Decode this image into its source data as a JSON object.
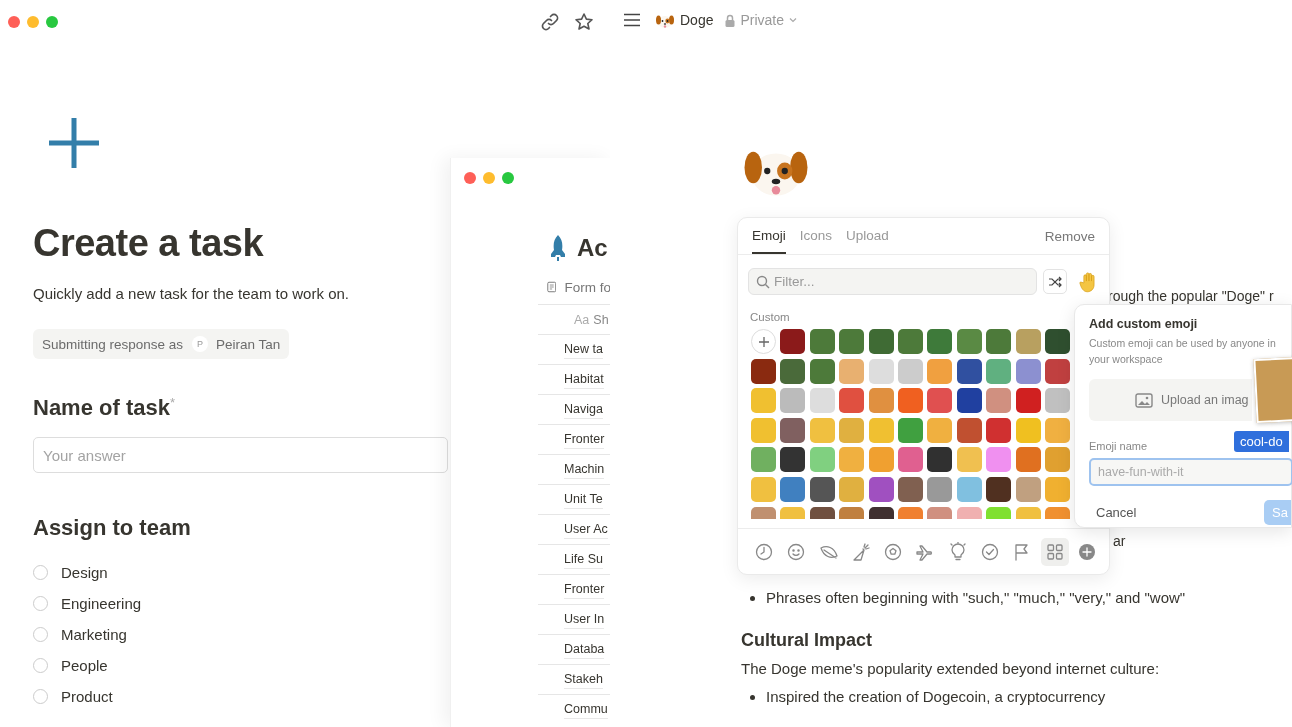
{
  "form_window": {
    "title": "Create a task",
    "description": "Quickly add a new task for the team to work on.",
    "respondent": {
      "label": "Submitting response as",
      "avatar": "P",
      "name": "Peiran Tan"
    },
    "question": {
      "label": "Name of task",
      "required_mark": "*",
      "placeholder": "Your answer"
    },
    "team_question": {
      "label": "Assign to team",
      "options": [
        {
          "label": "Design",
          "checked": false
        },
        {
          "label": "Engineering",
          "checked": false
        },
        {
          "label": "Marketing",
          "checked": false
        },
        {
          "label": "People",
          "checked": false
        },
        {
          "label": "Product",
          "checked": false
        }
      ]
    }
  },
  "database_window": {
    "title": "Ac",
    "view": "Form fo",
    "column_header": {
      "type_icon": "Aa",
      "label": "Sh"
    },
    "rows": [
      "New ta",
      "Habitat",
      "Naviga",
      "Fronter",
      "Machin",
      "Unit Te",
      "User Ac",
      "Life Su",
      "Fronter",
      "User In",
      "Databa",
      "Stakeh",
      "Commu"
    ]
  },
  "doge_page": {
    "breadcrumb": {
      "title": "Doge",
      "privacy": "Private"
    },
    "icon_picker": {
      "tabs": [
        {
          "label": "Emoji",
          "selected": true
        },
        {
          "label": "Icons",
          "selected": false
        },
        {
          "label": "Upload",
          "selected": false
        }
      ],
      "remove": "Remove",
      "filter_placeholder": "Filter...",
      "section_label": "Custom",
      "emoji": [
        {
          "color": "#8b1a1a"
        },
        {
          "color": "#4d7a3a"
        },
        {
          "color": "#4d7a3a"
        },
        {
          "color": "#3f6b34"
        },
        {
          "color": "#4d7a3a"
        },
        {
          "color": "#3e7a3a"
        },
        {
          "color": "#5a8a44"
        },
        {
          "color": "#4d7a3a"
        },
        {
          "color": "#b8a060"
        },
        {
          "color": "#2f4f2f"
        },
        {
          "color": "#8a2a10"
        },
        {
          "color": "#4a6a3a"
        },
        {
          "color": "#4d7a3a"
        },
        {
          "color": "#e8b070"
        },
        {
          "color": "#dddddd"
        },
        {
          "color": "#cccccc"
        },
        {
          "color": "#f0a040"
        },
        {
          "color": "#3050a0"
        },
        {
          "color": "#60b080"
        },
        {
          "color": "#8c90d0"
        },
        {
          "color": "#c04040"
        },
        {
          "color": "#f0c030"
        },
        {
          "color": "#bbbbbb"
        },
        {
          "color": "#dddddd"
        },
        {
          "color": "#e05040"
        },
        {
          "color": "#e09040"
        },
        {
          "color": "#f06020"
        },
        {
          "color": "#e05050"
        },
        {
          "color": "#2040a0"
        },
        {
          "color": "#d09080"
        },
        {
          "color": "#d02020"
        },
        {
          "color": "#c0c0c0"
        },
        {
          "color": "#f0c030"
        },
        {
          "color": "#806060"
        },
        {
          "color": "#f0c040"
        },
        {
          "color": "#e0b040"
        },
        {
          "color": "#f0c031"
        },
        {
          "color": "#40a040"
        },
        {
          "color": "#f0b040"
        },
        {
          "color": "#c05030"
        },
        {
          "color": "#d03030"
        },
        {
          "color": "#f0c020"
        },
        {
          "color": "#f0b041"
        },
        {
          "color": "#70b060"
        },
        {
          "color": "#333333"
        },
        {
          "color": "#80d080"
        },
        {
          "color": "#f0b040"
        },
        {
          "color": "#f0a030"
        },
        {
          "color": "#e06090"
        },
        {
          "color": "#303030"
        },
        {
          "color": "#f0c050"
        },
        {
          "color": "#f090f0"
        },
        {
          "color": "#e07020"
        },
        {
          "color": "#e0a030"
        },
        {
          "color": "#f0c040"
        },
        {
          "color": "#4080c0"
        },
        {
          "color": "#555555"
        },
        {
          "color": "#e0b040"
        },
        {
          "color": "#a050c0"
        },
        {
          "color": "#806050"
        },
        {
          "color": "#999999"
        },
        {
          "color": "#80c0e0"
        },
        {
          "color": "#503020"
        },
        {
          "color": "#c0a080"
        },
        {
          "color": "#f0b030"
        },
        {
          "color": "#c09070"
        },
        {
          "color": "#f0c040"
        },
        {
          "color": "#705040"
        },
        {
          "color": "#c08040"
        },
        {
          "color": "#403030"
        },
        {
          "color": "#f08030"
        },
        {
          "color": "#d09080"
        },
        {
          "color": "#f0b0b0"
        },
        {
          "color": "#80e030"
        },
        {
          "color": "#f0c040"
        },
        {
          "color": "#f09030"
        }
      ],
      "categories": [
        {
          "selected": false
        },
        {
          "selected": false
        },
        {
          "selected": false
        },
        {
          "selected": false
        },
        {
          "selected": false
        },
        {
          "selected": false
        },
        {
          "selected": false
        },
        {
          "selected": false
        },
        {
          "selected": false
        },
        {
          "selected": true
        },
        {
          "selected": false
        }
      ]
    },
    "custom_emoji_dialog": {
      "title": "Add custom emoji",
      "description": "Custom emoji can be used by anyone in your workspace",
      "upload_label": "Upload an imag",
      "name_label": "Emoji name",
      "drag_tag": "cool-do",
      "name_placeholder": "have-fun-with-it",
      "cancel": "Cancel",
      "save": "Sa"
    },
    "body": {
      "fragment_top": "rough the popular \"Doge\" r",
      "fragment_mid": "ar",
      "bullets_1": [
        "Phrases often beginning with \"such,\" \"much,\" \"very,\" and \"wow\""
      ],
      "heading": "Cultural Impact",
      "paragraph": "The Doge meme's popularity extended beyond internet culture:",
      "bullets_2": [
        "Inspired the creation of Dogecoin, a cryptocurrency"
      ]
    }
  }
}
